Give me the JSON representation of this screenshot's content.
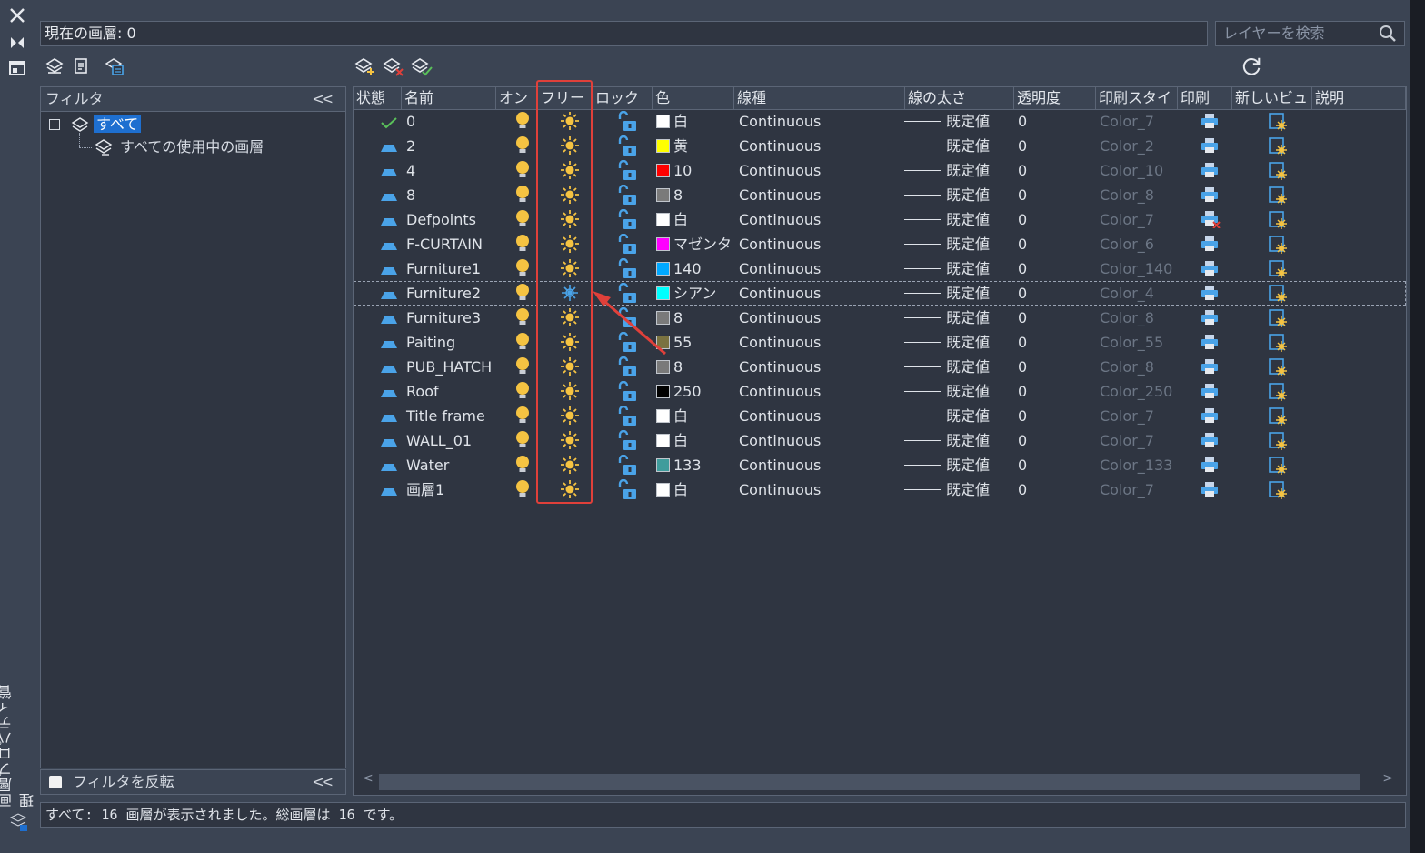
{
  "window": {
    "side_title": "画層プロパティ管理",
    "current_layer": "現在の画層: 0",
    "search_placeholder": "レイヤーを検索"
  },
  "filter_panel": {
    "header": "フィルタ",
    "tree_root": "すべて",
    "tree_child": "すべての使用中の画層",
    "invert_label": "フィルタを反転"
  },
  "columns": [
    "状態",
    "名前",
    "オン",
    "フリーズ",
    "ロック",
    "色",
    "線種",
    "線の太さ",
    "透明度",
    "印刷スタイル",
    "印刷",
    "新しいビューポート",
    "説明"
  ],
  "column_headers_shown": [
    "状態",
    "名前",
    "オン",
    "フリー",
    "ロック",
    "色",
    "線種",
    "線の太さ",
    "透明度",
    "印刷スタイ",
    "印刷",
    "新しいビュ",
    "説明"
  ],
  "layers": [
    {
      "name": "0",
      "current": true,
      "color_hex": "#ffffff",
      "color_name": "白",
      "linetype": "Continuous",
      "lineweight": "既定値",
      "transparency": "0",
      "plot_style": "Color_7",
      "plot": true,
      "freeze_state": "thawed"
    },
    {
      "name": "2",
      "current": false,
      "color_hex": "#ffff00",
      "color_name": "黄",
      "linetype": "Continuous",
      "lineweight": "既定値",
      "transparency": "0",
      "plot_style": "Color_2",
      "plot": true,
      "freeze_state": "thawed"
    },
    {
      "name": "4",
      "current": false,
      "color_hex": "#ff0000",
      "color_name": "10",
      "linetype": "Continuous",
      "lineweight": "既定値",
      "transparency": "0",
      "plot_style": "Color_10",
      "plot": true,
      "freeze_state": "thawed"
    },
    {
      "name": "8",
      "current": false,
      "color_hex": "#7a7a7a",
      "color_name": "8",
      "linetype": "Continuous",
      "lineweight": "既定値",
      "transparency": "0",
      "plot_style": "Color_8",
      "plot": true,
      "freeze_state": "thawed"
    },
    {
      "name": "Defpoints",
      "current": false,
      "color_hex": "#ffffff",
      "color_name": "白",
      "linetype": "Continuous",
      "lineweight": "既定値",
      "transparency": "0",
      "plot_style": "Color_7",
      "plot": false,
      "freeze_state": "thawed"
    },
    {
      "name": "F-CURTAIN",
      "current": false,
      "color_hex": "#ff00ff",
      "color_name": "マゼンタ",
      "linetype": "Continuous",
      "lineweight": "既定値",
      "transparency": "0",
      "plot_style": "Color_6",
      "plot": true,
      "freeze_state": "thawed"
    },
    {
      "name": "Furniture1",
      "current": false,
      "color_hex": "#00a8ff",
      "color_name": "140",
      "linetype": "Continuous",
      "lineweight": "既定値",
      "transparency": "0",
      "plot_style": "Color_140",
      "plot": true,
      "freeze_state": "thawed"
    },
    {
      "name": "Furniture2",
      "current": false,
      "color_hex": "#00ffff",
      "color_name": "シアン",
      "linetype": "Continuous",
      "lineweight": "既定値",
      "transparency": "0",
      "plot_style": "Color_4",
      "plot": true,
      "freeze_state": "frozen",
      "selected": true
    },
    {
      "name": "Furniture3",
      "current": false,
      "color_hex": "#7a7a7a",
      "color_name": "8",
      "linetype": "Continuous",
      "lineweight": "既定値",
      "transparency": "0",
      "plot_style": "Color_8",
      "plot": true,
      "freeze_state": "thawed"
    },
    {
      "name": "Paiting",
      "current": false,
      "color_hex": "#7a7240",
      "color_name": "55",
      "linetype": "Continuous",
      "lineweight": "既定値",
      "transparency": "0",
      "plot_style": "Color_55",
      "plot": true,
      "freeze_state": "thawed"
    },
    {
      "name": "PUB_HATCH",
      "current": false,
      "color_hex": "#7a7a7a",
      "color_name": "8",
      "linetype": "Continuous",
      "lineweight": "既定値",
      "transparency": "0",
      "plot_style": "Color_8",
      "plot": true,
      "freeze_state": "thawed"
    },
    {
      "name": "Roof",
      "current": false,
      "color_hex": "#000000",
      "color_name": "250",
      "linetype": "Continuous",
      "lineweight": "既定値",
      "transparency": "0",
      "plot_style": "Color_250",
      "plot": true,
      "freeze_state": "thawed"
    },
    {
      "name": "Title frame",
      "current": false,
      "color_hex": "#ffffff",
      "color_name": "白",
      "linetype": "Continuous",
      "lineweight": "既定値",
      "transparency": "0",
      "plot_style": "Color_7",
      "plot": true,
      "freeze_state": "thawed"
    },
    {
      "name": "WALL_01",
      "current": false,
      "color_hex": "#ffffff",
      "color_name": "白",
      "linetype": "Continuous",
      "lineweight": "既定値",
      "transparency": "0",
      "plot_style": "Color_7",
      "plot": true,
      "freeze_state": "thawed"
    },
    {
      "name": "Water",
      "current": false,
      "color_hex": "#3f9c9c",
      "color_name": "133",
      "linetype": "Continuous",
      "lineweight": "既定値",
      "transparency": "0",
      "plot_style": "Color_133",
      "plot": true,
      "freeze_state": "thawed"
    },
    {
      "name": "画層1",
      "current": false,
      "color_hex": "#ffffff",
      "color_name": "白",
      "linetype": "Continuous",
      "lineweight": "既定値",
      "transparency": "0",
      "plot_style": "Color_7",
      "plot": true,
      "freeze_state": "thawed"
    }
  ],
  "status_bar": "すべて: 16 画層が表示されました。総画層は 16 です。",
  "colors": {
    "accent_selection": "#1e6fd0",
    "bulb_on": "#f5c342",
    "sun_thawed": "#f5c342",
    "snowflake_frozen": "#4aa3e8",
    "lock_open": "#4aa3e8",
    "highlight_annotation": "#e0403a",
    "current_check": "#5ac05a"
  },
  "icons": [
    "close-icon",
    "auto-hide-icon",
    "properties-icon",
    "new-property-filter-icon",
    "new-group-filter-icon",
    "layer-states-manager-icon",
    "new-layer-icon",
    "delete-layer-icon",
    "set-current-icon",
    "refresh-icon",
    "search-icon"
  ]
}
